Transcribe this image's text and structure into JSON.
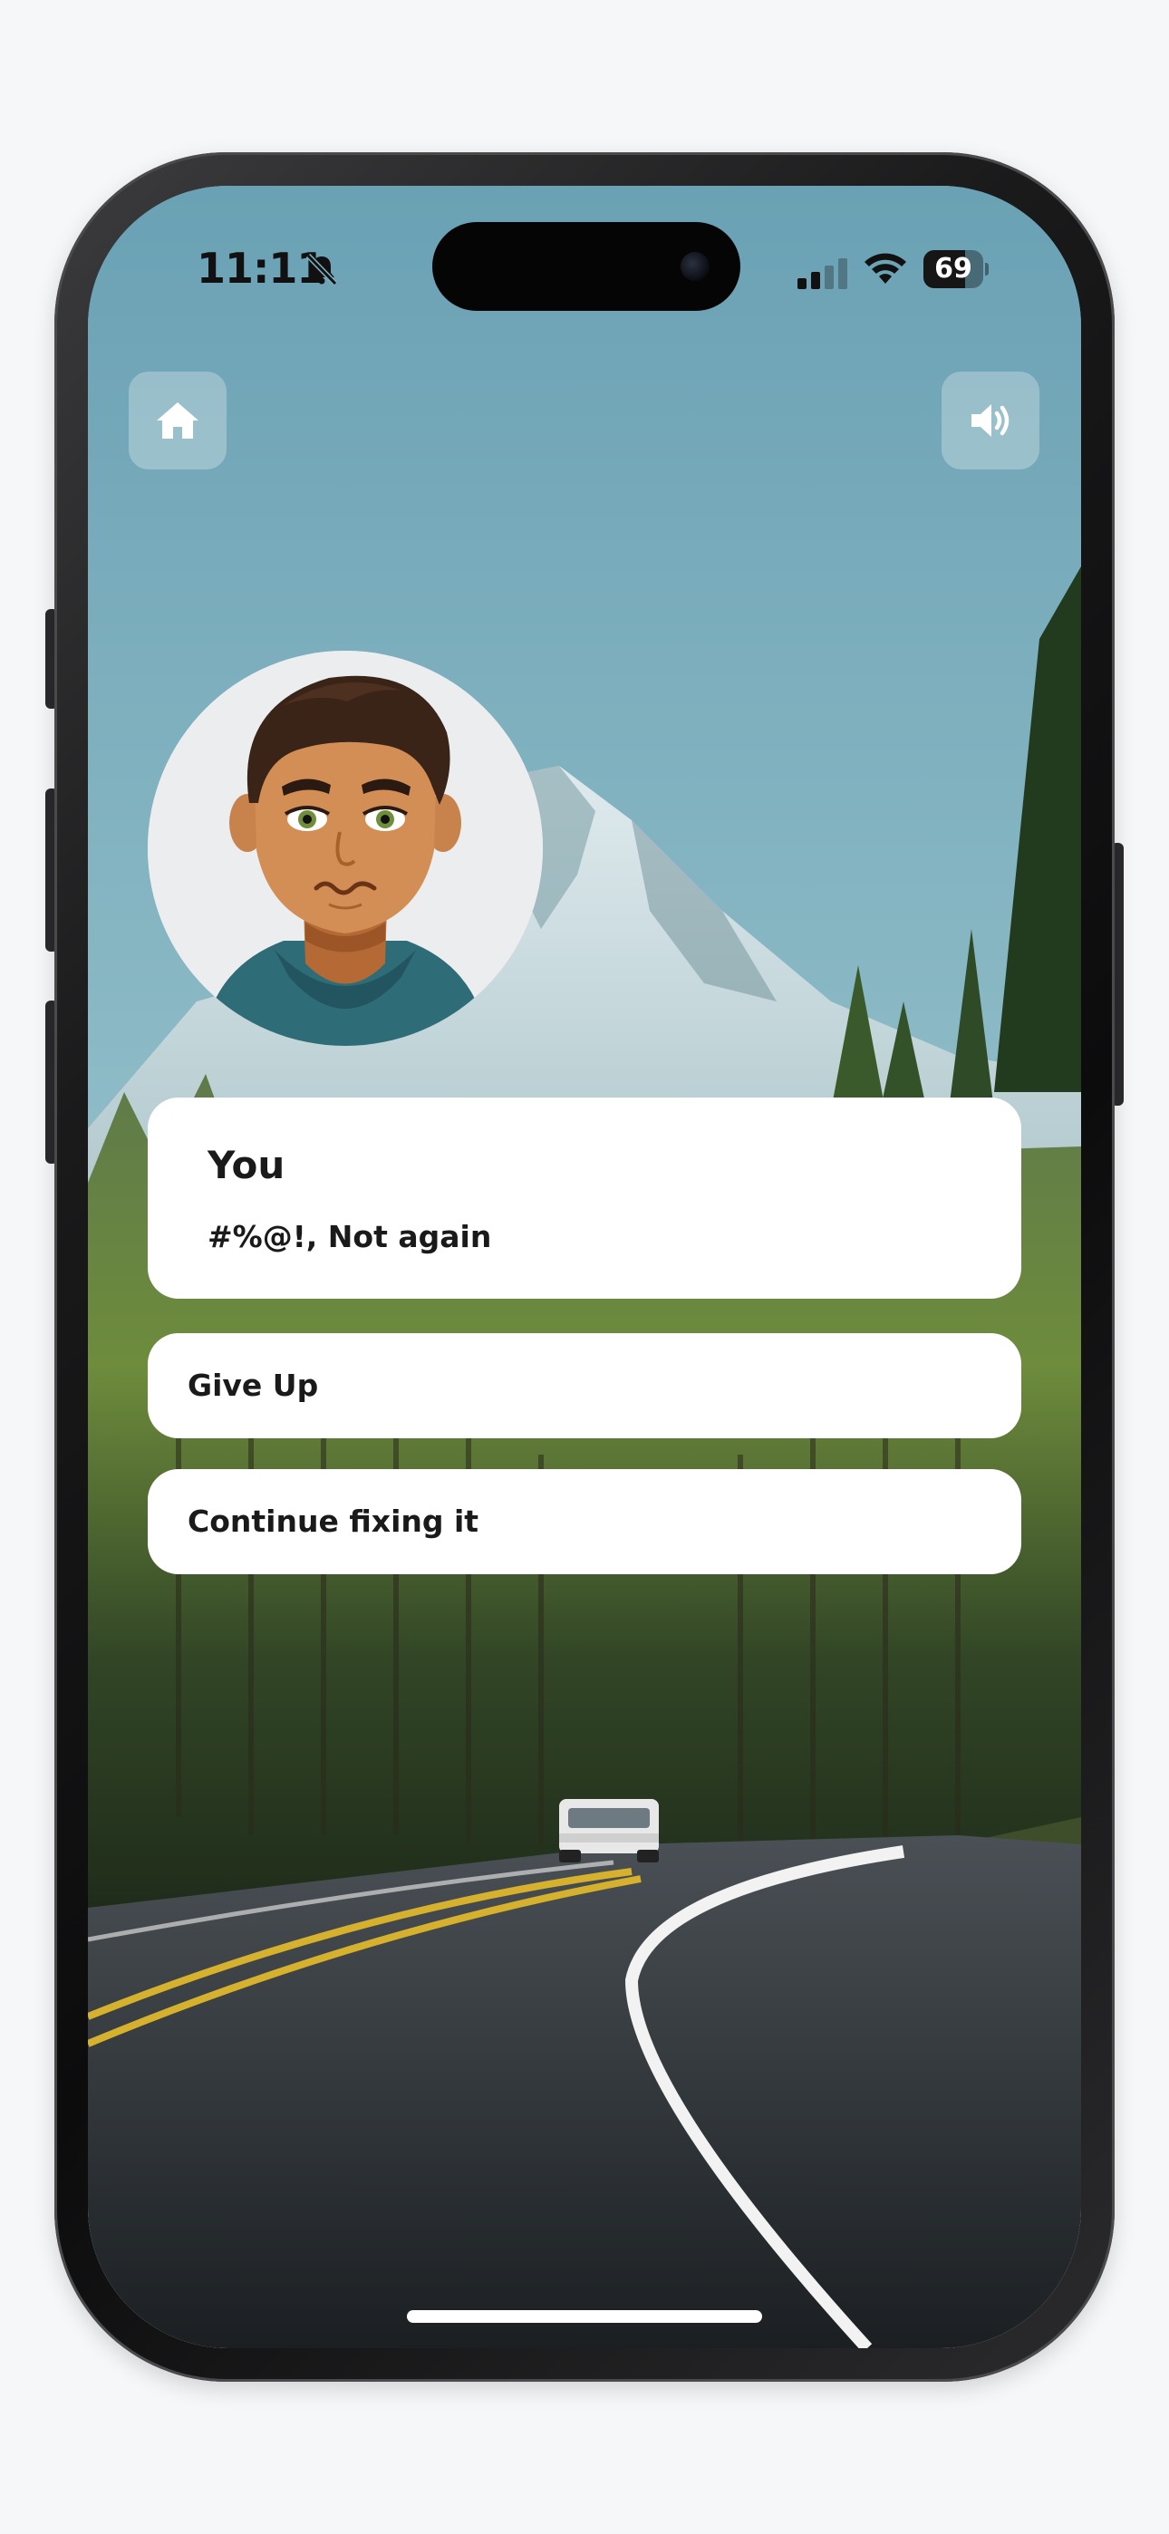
{
  "status_bar": {
    "time": "11:11",
    "battery_level": "69",
    "battery_fraction": 0.69,
    "icons": [
      "bell-slash-icon",
      "cellular-signal-icon",
      "wifi-icon",
      "battery-icon"
    ]
  },
  "controls": {
    "home_icon": "home-icon",
    "sound_icon": "speaker-volume-icon"
  },
  "dialogue": {
    "speaker": "You",
    "line": "#%@!, Not again"
  },
  "choices": [
    {
      "label": "Give Up"
    },
    {
      "label": "Continue fixing it"
    }
  ],
  "colors": {
    "card_background": "#ffffff",
    "text": "#1a1a1a",
    "control_tint": "rgba(255,255,255,0.28)"
  }
}
